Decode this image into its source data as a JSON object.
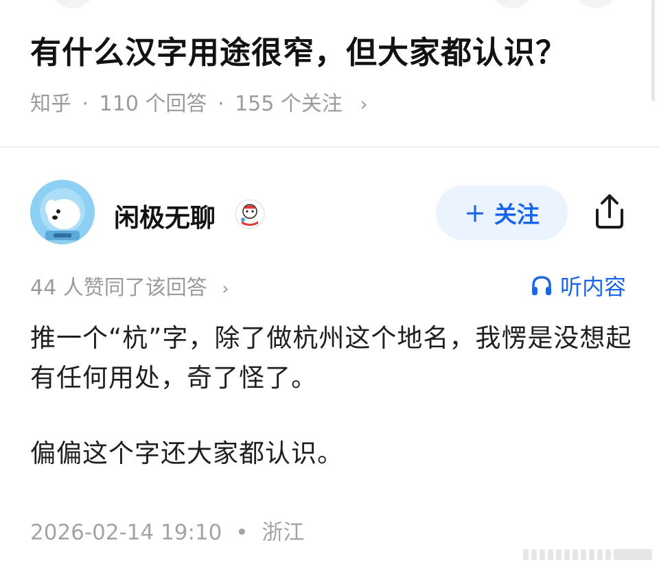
{
  "question": {
    "title": "有什么汉字用途很窄，但大家都认识？",
    "source": "知乎",
    "answer_count": "110 个回答",
    "follow_count": "155 个关注",
    "separator": "·",
    "chevron": "›"
  },
  "author": {
    "name": "闲极无聊",
    "follow_label": "关注",
    "follow_plus": "+",
    "avatar_icon": "astronaut-dog-avatar-icon",
    "badge_icon": "cartoon-badge-icon"
  },
  "stats": {
    "upvote_text": "44 人赞同了该回答",
    "chevron": "›",
    "listen_label": "听内容"
  },
  "content": {
    "paragraph1": "推一个“杭”字，除了做杭州这个地名，我愣是没想起有任何用处，奇了怪了。",
    "paragraph2": "偏偏这个字还大家都认识。"
  },
  "footer": {
    "date": "2026-02-14 19:10",
    "dot": "•",
    "location": "浙江"
  },
  "colors": {
    "accent": "#1967e8",
    "follow_bg": "#ebf3fe",
    "meta_gray": "#9a9aa0"
  }
}
